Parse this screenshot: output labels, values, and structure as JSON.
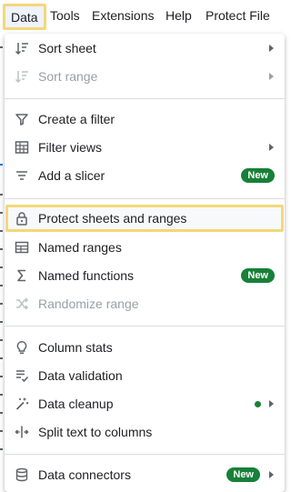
{
  "menubar": {
    "data": "Data",
    "tools": "Tools",
    "extensions": "Extensions",
    "help": "Help",
    "protect_file": "Protect File"
  },
  "menu": {
    "sort_sheet": "Sort sheet",
    "sort_range": "Sort range",
    "create_filter": "Create a filter",
    "filter_views": "Filter views",
    "add_slicer": "Add a slicer",
    "protect_sheets": "Protect sheets and ranges",
    "named_ranges": "Named ranges",
    "named_functions": "Named functions",
    "randomize_range": "Randomize range",
    "column_stats": "Column stats",
    "data_validation": "Data validation",
    "data_cleanup": "Data cleanup",
    "split_text": "Split text to columns",
    "data_connectors": "Data connectors",
    "new_badge": "New"
  },
  "colors": {
    "highlight_border": "#f3d77a",
    "badge_green": "#188038",
    "disabled_text": "#9aa0a6"
  }
}
